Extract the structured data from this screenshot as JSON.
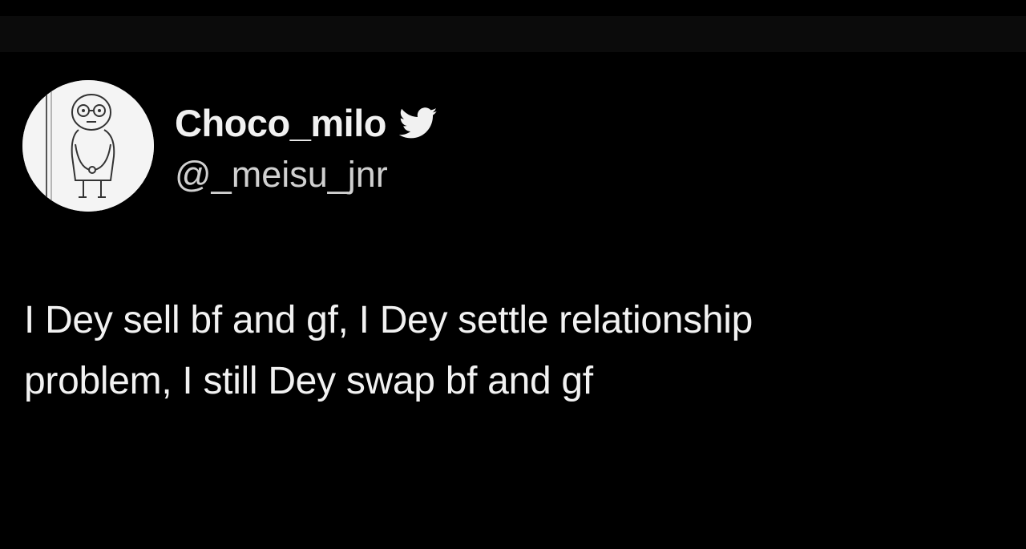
{
  "tweet": {
    "display_name": "Choco_milo",
    "handle": "@_meisu_jnr",
    "text": "I Dey sell bf and gf, I Dey settle relationship\nproblem, I still Dey swap bf and gf",
    "verified_icon": "twitter-bird-icon",
    "avatar_icon": "stick-figure-avatar"
  },
  "colors": {
    "background": "#000000",
    "top_bar": "#0b0b0b",
    "name_text": "#f1f1f1",
    "handle_text": "#d0d0d0",
    "body_text": "#f2f2f2",
    "avatar_bg": "#f4f4f4"
  }
}
